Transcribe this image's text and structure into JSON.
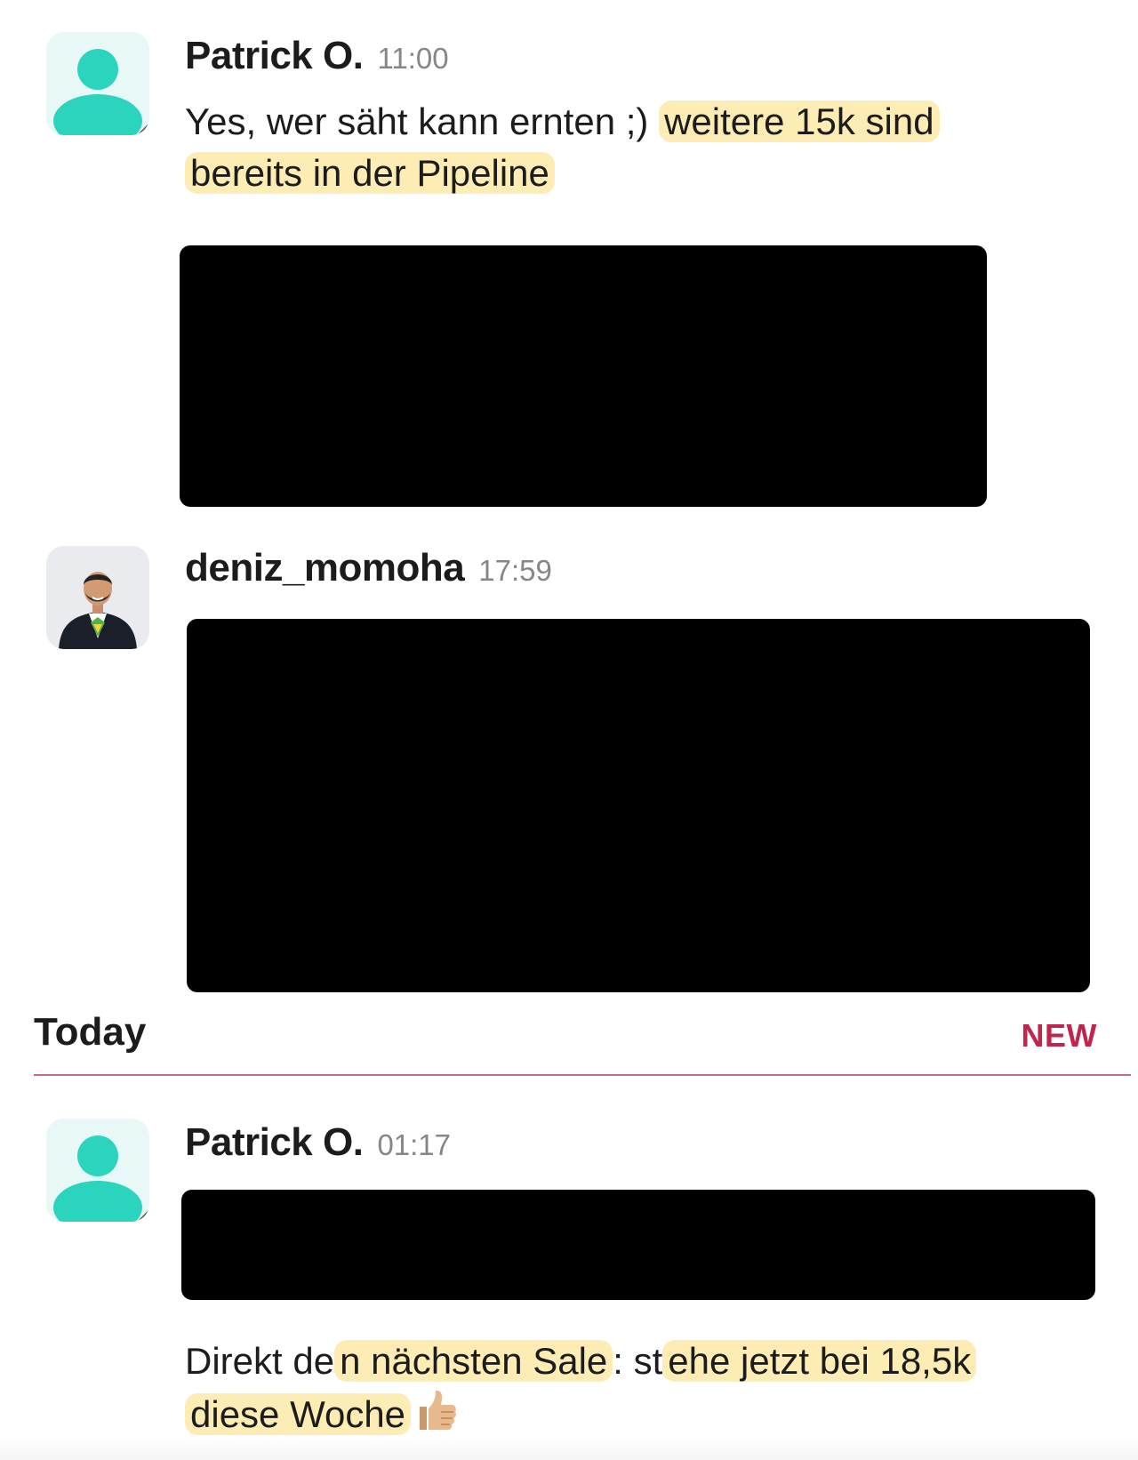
{
  "messages": [
    {
      "author": "Patrick O.",
      "time": "11:00",
      "avatar_icon": "user-silhouette-icon",
      "text_plain": "Yes, wer säht kann ernten ;) ",
      "text_highlight_1": "weitere 15k sind",
      "text_highlight_2": "bereits in der Pipeline",
      "attachment": "redacted"
    },
    {
      "author": "deniz_momoha",
      "time": "17:59",
      "avatar_icon": "profile-photo",
      "attachment": "redacted"
    }
  ],
  "divider": {
    "label": "Today",
    "badge": "NEW"
  },
  "today_messages": [
    {
      "author": "Patrick O.",
      "time": "01:17",
      "avatar_icon": "user-silhouette-icon",
      "attachment": "redacted",
      "text_line1_plain_a": "Direkt de",
      "text_line1_hl_a": "n nächsten Sale",
      "text_line1_plain_b": ": st",
      "text_line1_hl_b": "ehe jetzt bei 18,5k",
      "text_line2_hl": "diese Woche",
      "emoji": "thumbs-up-icon"
    }
  ],
  "colors": {
    "avatar_teal": "#2bd4bd",
    "new_badge": "#c0264d",
    "highlight": "#fddc78"
  }
}
